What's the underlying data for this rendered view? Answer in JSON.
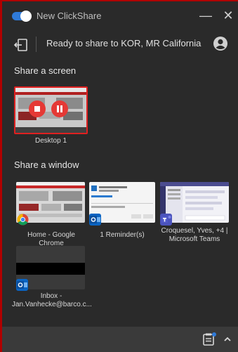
{
  "titlebar": {
    "title": "New ClickShare",
    "minimize_glyph": "—",
    "close_glyph": "✕",
    "toggle_state": "on",
    "toggle_color": "#2f7ad8"
  },
  "status": {
    "text": "Ready to share to KOR, MR California",
    "exit_icon": "exit-icon",
    "account_icon": "account-icon"
  },
  "share_screen": {
    "heading": "Share a screen",
    "screens": [
      {
        "label": "Desktop 1",
        "selected": true,
        "stop_icon": "stop-icon",
        "pause_icon": "pause-icon"
      }
    ]
  },
  "share_window": {
    "heading": "Share a window",
    "windows": [
      {
        "label": "Home - Google Chrome",
        "app_icon": "chrome-icon"
      },
      {
        "label": "1 Reminder(s)",
        "app_icon": "outlook-icon"
      },
      {
        "label_line1": "Croquesel, Yves, +4 |",
        "label_line2": "Microsoft Teams",
        "app_icon": "teams-icon"
      },
      {
        "label_line1": "Inbox -",
        "label_line2": "Jan.Vanhecke@barco.c...",
        "app_icon": "outlook-icon"
      }
    ]
  },
  "footer": {
    "notes_icon": "notes-icon",
    "expand_icon": "chevron-up-icon",
    "notification_dot_color": "#2f7ad8"
  },
  "colors": {
    "selected_border": "#e02020",
    "accent_red": "#e53935",
    "background": "#2a2a2a"
  }
}
